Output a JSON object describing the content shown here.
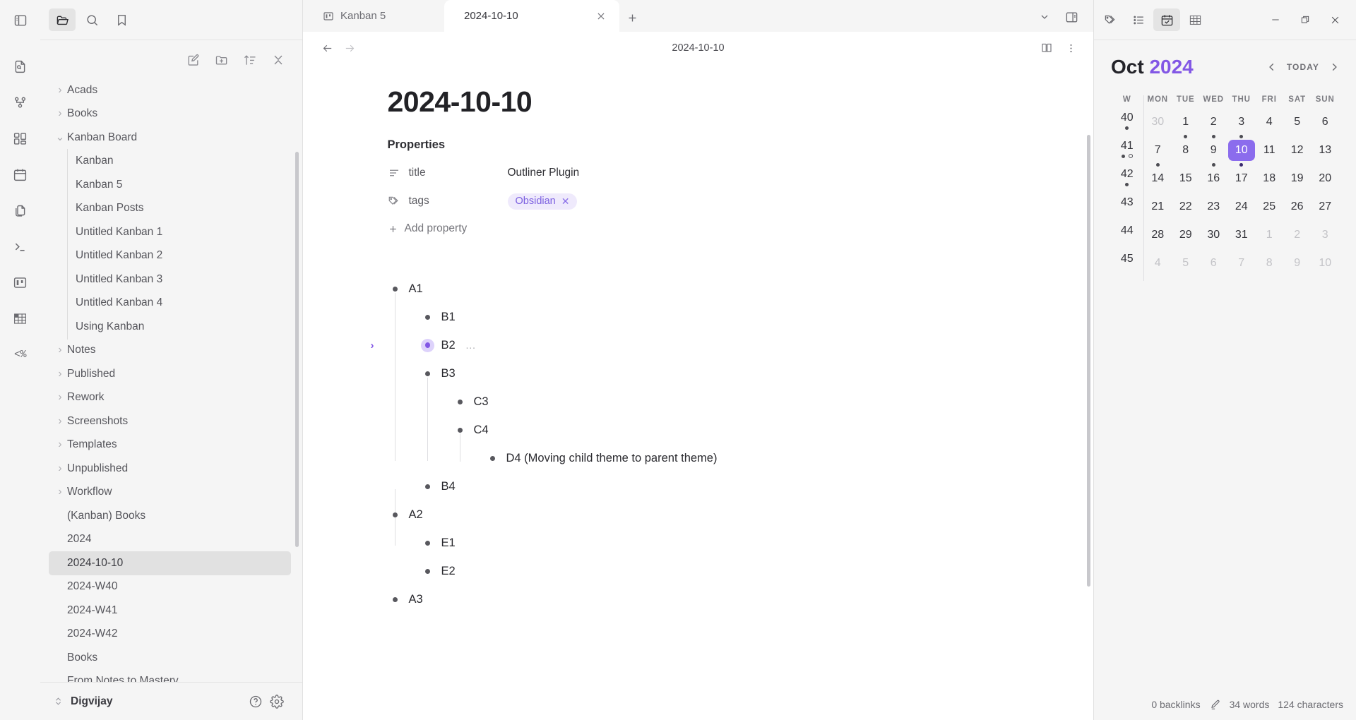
{
  "ribbon": {
    "sidebar_toggle": "toggle-left-sidebar",
    "items": [
      {
        "name": "quick-switcher-icon",
        "label": "Quick switcher"
      },
      {
        "name": "graph-view-icon",
        "label": "Graph view"
      },
      {
        "name": "canvas-icon",
        "label": "Canvas"
      },
      {
        "name": "calendar-icon",
        "label": "Calendar"
      },
      {
        "name": "copy-note-icon",
        "label": "Copy note"
      },
      {
        "name": "terminal-icon",
        "label": "Terminal"
      },
      {
        "name": "kanban-icon",
        "label": "Kanban"
      },
      {
        "name": "table-icon",
        "label": "Table"
      },
      {
        "name": "templater-icon",
        "label": "<%"
      }
    ]
  },
  "sidebar": {
    "tabs": [
      {
        "name": "files-tab",
        "icon": "folder-icon",
        "active": true
      },
      {
        "name": "search-tab",
        "icon": "search-icon",
        "active": false
      },
      {
        "name": "bookmarks-tab",
        "icon": "bookmark-icon",
        "active": false
      }
    ],
    "toolbar": [
      {
        "name": "new-note-button",
        "icon": "pencil-square-icon"
      },
      {
        "name": "new-folder-button",
        "icon": "folder-plus-icon"
      },
      {
        "name": "sort-order-button",
        "icon": "sort-asc-icon"
      },
      {
        "name": "collapse-all-button",
        "icon": "chevrons-collapse-icon"
      }
    ],
    "tree": [
      {
        "label": "Acads",
        "type": "folder",
        "expanded": false,
        "indent": 0
      },
      {
        "label": "Books",
        "type": "folder",
        "expanded": false,
        "indent": 0
      },
      {
        "label": "Kanban Board",
        "type": "folder",
        "expanded": true,
        "indent": 0
      },
      {
        "label": "Kanban",
        "type": "file",
        "indent": 1
      },
      {
        "label": "Kanban 5",
        "type": "file",
        "indent": 1
      },
      {
        "label": "Kanban Posts",
        "type": "file",
        "indent": 1
      },
      {
        "label": "Untitled Kanban 1",
        "type": "file",
        "indent": 1
      },
      {
        "label": "Untitled Kanban 2",
        "type": "file",
        "indent": 1
      },
      {
        "label": "Untitled Kanban 3",
        "type": "file",
        "indent": 1
      },
      {
        "label": "Untitled Kanban 4",
        "type": "file",
        "indent": 1
      },
      {
        "label": "Using Kanban",
        "type": "file",
        "indent": 1
      },
      {
        "label": "Notes",
        "type": "folder",
        "expanded": false,
        "indent": 0
      },
      {
        "label": "Published",
        "type": "folder",
        "expanded": false,
        "indent": 0
      },
      {
        "label": "Rework",
        "type": "folder",
        "expanded": false,
        "indent": 0
      },
      {
        "label": "Screenshots",
        "type": "folder",
        "expanded": false,
        "indent": 0
      },
      {
        "label": "Templates",
        "type": "folder",
        "expanded": false,
        "indent": 0
      },
      {
        "label": "Unpublished",
        "type": "folder",
        "expanded": false,
        "indent": 0
      },
      {
        "label": "Workflow",
        "type": "folder",
        "expanded": false,
        "indent": 0
      },
      {
        "label": "(Kanban) Books",
        "type": "file",
        "indent": 0
      },
      {
        "label": "2024",
        "type": "file",
        "indent": 0
      },
      {
        "label": "2024-10-10",
        "type": "file",
        "indent": 0,
        "selected": true
      },
      {
        "label": "2024-W40",
        "type": "file",
        "indent": 0
      },
      {
        "label": "2024-W41",
        "type": "file",
        "indent": 0
      },
      {
        "label": "2024-W42",
        "type": "file",
        "indent": 0
      },
      {
        "label": "Books",
        "type": "file",
        "indent": 0
      },
      {
        "label": "From Notes to Mastery",
        "type": "file",
        "indent": 0
      }
    ],
    "footer": {
      "vault_name": "Digvijay",
      "help_icon": "help-circle-icon",
      "settings_icon": "gear-icon",
      "vault_switcher_icon": "vault-switcher-icon"
    }
  },
  "tabbar": {
    "tabs": [
      {
        "label": "Kanban 5",
        "icon": "kanban-icon",
        "active": false,
        "closable": false
      },
      {
        "label": "2024-10-10",
        "icon": "",
        "active": true,
        "closable": true
      }
    ],
    "new_tab_label": "+",
    "right_icons": [
      {
        "name": "tab-list-dropdown-icon",
        "glyph": "chevron-down"
      },
      {
        "name": "toggle-right-sidebar-icon",
        "glyph": "right-sidebar"
      }
    ]
  },
  "editor": {
    "back_label": "←",
    "forward_label": "→",
    "inline_title": "2024-10-10",
    "reading_view_icon": "book-open-icon",
    "more_options_icon": "vertical-dots-icon",
    "title": "2024-10-10",
    "properties_heading": "Properties",
    "properties": [
      {
        "key": "title",
        "icon": "text-lines-icon",
        "value": "Outliner Plugin",
        "type": "text"
      },
      {
        "key": "tags",
        "icon": "tags-icon",
        "value": "Obsidian",
        "type": "tag",
        "remove_label": "✕"
      }
    ],
    "add_property_label": "Add property",
    "add_property_icon": "plus-icon",
    "outline": [
      {
        "text": "A1",
        "level": 1,
        "collapsed": false,
        "ellipsis": false
      },
      {
        "text": "B1",
        "level": 2,
        "collapsed": false,
        "ellipsis": false
      },
      {
        "text": "B2",
        "level": 2,
        "collapsed": true,
        "ellipsis": true
      },
      {
        "text": "B3",
        "level": 2,
        "collapsed": false,
        "ellipsis": false
      },
      {
        "text": "C3",
        "level": 3,
        "collapsed": false,
        "ellipsis": false
      },
      {
        "text": "C4",
        "level": 3,
        "collapsed": false,
        "ellipsis": false
      },
      {
        "text": "D4 (Moving child theme to parent theme)",
        "level": 4,
        "collapsed": false,
        "ellipsis": false
      },
      {
        "text": "B4",
        "level": 2,
        "collapsed": false,
        "ellipsis": false
      },
      {
        "text": "A2",
        "level": 1,
        "collapsed": false,
        "ellipsis": false
      },
      {
        "text": "E1",
        "level": 2,
        "collapsed": false,
        "ellipsis": false
      },
      {
        "text": "E2",
        "level": 2,
        "collapsed": false,
        "ellipsis": false
      },
      {
        "text": "A3",
        "level": 1,
        "collapsed": false,
        "ellipsis": false
      }
    ]
  },
  "rightpanel": {
    "tabs": [
      {
        "name": "tags-pane-tab",
        "icon": "tags-icon",
        "active": false
      },
      {
        "name": "outline-pane-tab",
        "icon": "list-icon",
        "active": false
      },
      {
        "name": "calendar-pane-tab",
        "icon": "calendar-check-icon",
        "active": true
      },
      {
        "name": "table-pane-tab",
        "icon": "table-icon",
        "active": false
      }
    ],
    "window_controls": [
      {
        "name": "minimize-button",
        "glyph": "—"
      },
      {
        "name": "maximize-button",
        "glyph": "❐"
      },
      {
        "name": "close-button",
        "glyph": "✕"
      }
    ],
    "calendar": {
      "month": "Oct",
      "year": "2024",
      "prev_label": "‹",
      "today_label": "TODAY",
      "next_label": "›",
      "headers": [
        "W",
        "MON",
        "TUE",
        "WED",
        "THU",
        "FRI",
        "SAT",
        "SUN"
      ],
      "accent_color": "#8257e5",
      "selected_bg": "#8b6ced",
      "weeks": [
        {
          "week": "40",
          "week_dots": [
            "filled"
          ],
          "days": [
            {
              "n": "30",
              "muted": true,
              "dots": []
            },
            {
              "n": "1",
              "muted": false,
              "dots": [
                "filled"
              ]
            },
            {
              "n": "2",
              "muted": false,
              "dots": [
                "filled"
              ]
            },
            {
              "n": "3",
              "muted": false,
              "dots": [
                "filled"
              ]
            },
            {
              "n": "4",
              "muted": false,
              "dots": []
            },
            {
              "n": "5",
              "muted": false,
              "dots": []
            },
            {
              "n": "6",
              "muted": false,
              "dots": []
            }
          ]
        },
        {
          "week": "41",
          "week_dots": [
            "filled",
            "hollow"
          ],
          "days": [
            {
              "n": "7",
              "muted": false,
              "dots": [
                "filled"
              ]
            },
            {
              "n": "8",
              "muted": false,
              "dots": []
            },
            {
              "n": "9",
              "muted": false,
              "dots": [
                "filled"
              ]
            },
            {
              "n": "10",
              "muted": false,
              "dots": [
                "filled"
              ],
              "selected": true
            },
            {
              "n": "11",
              "muted": false,
              "dots": []
            },
            {
              "n": "12",
              "muted": false,
              "dots": []
            },
            {
              "n": "13",
              "muted": false,
              "dots": []
            }
          ]
        },
        {
          "week": "42",
          "week_dots": [
            "filled"
          ],
          "days": [
            {
              "n": "14",
              "muted": false,
              "dots": []
            },
            {
              "n": "15",
              "muted": false,
              "dots": []
            },
            {
              "n": "16",
              "muted": false,
              "dots": []
            },
            {
              "n": "17",
              "muted": false,
              "dots": []
            },
            {
              "n": "18",
              "muted": false,
              "dots": []
            },
            {
              "n": "19",
              "muted": false,
              "dots": []
            },
            {
              "n": "20",
              "muted": false,
              "dots": []
            }
          ]
        },
        {
          "week": "43",
          "week_dots": [],
          "days": [
            {
              "n": "21",
              "muted": false,
              "dots": []
            },
            {
              "n": "22",
              "muted": false,
              "dots": []
            },
            {
              "n": "23",
              "muted": false,
              "dots": []
            },
            {
              "n": "24",
              "muted": false,
              "dots": []
            },
            {
              "n": "25",
              "muted": false,
              "dots": []
            },
            {
              "n": "26",
              "muted": false,
              "dots": []
            },
            {
              "n": "27",
              "muted": false,
              "dots": []
            }
          ]
        },
        {
          "week": "44",
          "week_dots": [],
          "days": [
            {
              "n": "28",
              "muted": false,
              "dots": []
            },
            {
              "n": "29",
              "muted": false,
              "dots": []
            },
            {
              "n": "30",
              "muted": false,
              "dots": []
            },
            {
              "n": "31",
              "muted": false,
              "dots": []
            },
            {
              "n": "1",
              "muted": true,
              "dots": []
            },
            {
              "n": "2",
              "muted": true,
              "dots": []
            },
            {
              "n": "3",
              "muted": true,
              "dots": []
            }
          ]
        },
        {
          "week": "45",
          "week_dots": [],
          "days": [
            {
              "n": "4",
              "muted": true,
              "dots": []
            },
            {
              "n": "5",
              "muted": true,
              "dots": []
            },
            {
              "n": "6",
              "muted": true,
              "dots": []
            },
            {
              "n": "7",
              "muted": true,
              "dots": []
            },
            {
              "n": "8",
              "muted": true,
              "dots": []
            },
            {
              "n": "9",
              "muted": true,
              "dots": []
            },
            {
              "n": "10",
              "muted": true,
              "dots": []
            }
          ]
        }
      ]
    }
  },
  "statusbar": {
    "backlinks": "0 backlinks",
    "edit_icon": "pencil-icon",
    "words": "34 words",
    "characters": "124 characters"
  }
}
